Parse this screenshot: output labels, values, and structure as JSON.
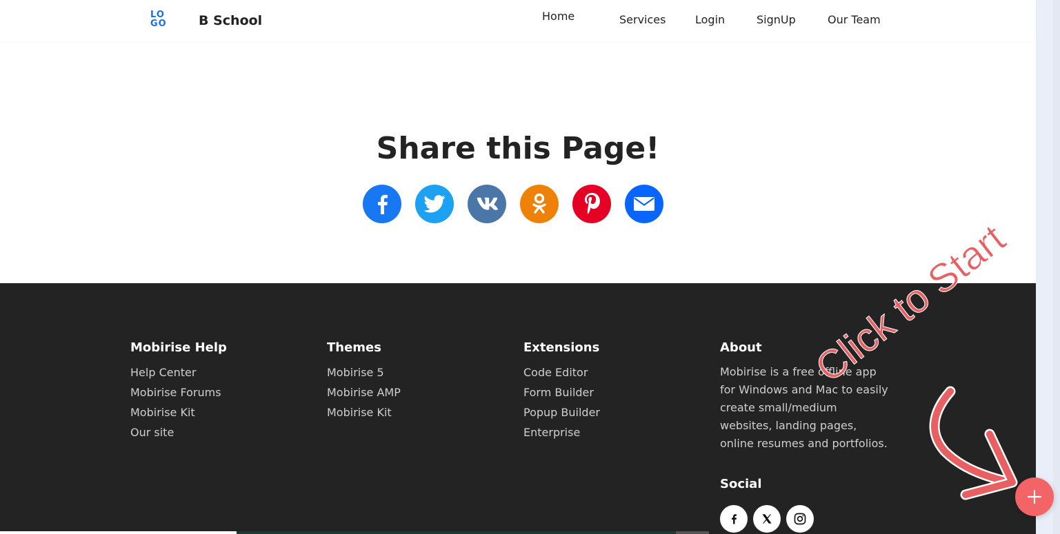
{
  "brand": {
    "logo_line1": "LO",
    "logo_line2": "GO",
    "name": "B School"
  },
  "nav": {
    "home": "Home",
    "services": "Services",
    "login": "Login",
    "signup": "SignUp",
    "team": "Our Team"
  },
  "share": {
    "title": "Share this Page!",
    "buttons": [
      {
        "name": "facebook-share-button",
        "icon": "facebook-icon",
        "color": "#1877f2"
      },
      {
        "name": "twitter-share-button",
        "icon": "twitter-icon",
        "color": "#1da1f2"
      },
      {
        "name": "vk-share-button",
        "icon": "vk-icon",
        "color": "#4a76a8"
      },
      {
        "name": "ok-share-button",
        "icon": "odnoklassniki-icon",
        "color": "#ee8208"
      },
      {
        "name": "pinterest-share-button",
        "icon": "pinterest-icon",
        "color": "#e60023"
      },
      {
        "name": "email-share-button",
        "icon": "mail-icon",
        "color": "#0866ff"
      }
    ]
  },
  "footer": {
    "help": {
      "title": "Mobirise Help",
      "links": [
        "Help Center",
        "Mobirise Forums",
        "Mobirise Kit",
        "Our site"
      ]
    },
    "themes": {
      "title": "Themes",
      "links": [
        "Mobirise 5",
        "Mobirise AMP",
        "Mobirise Kit"
      ]
    },
    "extensions": {
      "title": "Extensions",
      "links": [
        "Code Editor",
        "Form Builder",
        "Popup Builder",
        "Enterprise"
      ]
    },
    "about": {
      "title": "About",
      "text": "Mobirise is a free offline app for Windows and Mac to easily create small/medium websites, landing pages, online resumes and portfolios."
    },
    "social": {
      "title": "Social",
      "icons": [
        "facebook-icon",
        "twitter-icon",
        "instagram-icon"
      ]
    }
  },
  "overlay": {
    "hint": "Click to Start",
    "fab_icon": "plus-icon"
  },
  "colors": {
    "footer_bg": "#232323",
    "accent_red": "#f36466",
    "logo_blue": "#1a6ee8"
  }
}
